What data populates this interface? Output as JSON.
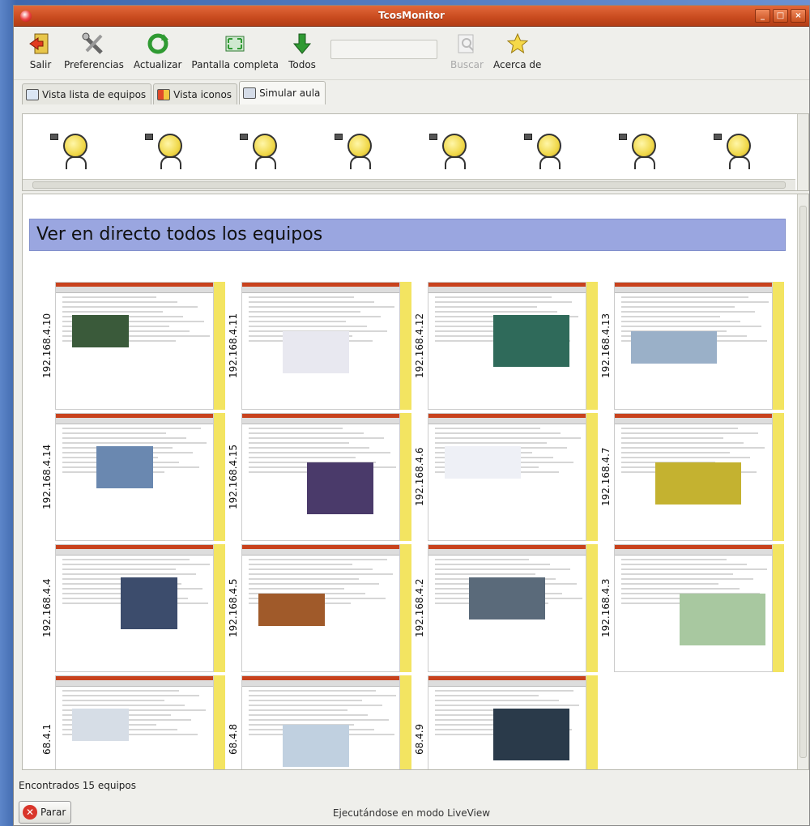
{
  "window": {
    "title": "TcosMonitor"
  },
  "toolbar": {
    "items": [
      {
        "label": "Salir",
        "icon": "exit-icon"
      },
      {
        "label": "Preferencias",
        "icon": "tools-icon"
      },
      {
        "label": "Actualizar",
        "icon": "refresh-icon"
      },
      {
        "label": "Pantalla completa",
        "icon": "fullscreen-icon"
      },
      {
        "label": "Todos",
        "icon": "down-arrow-icon"
      }
    ],
    "search_label": "Buscar",
    "about_label": "Acerca de"
  },
  "tabs": [
    {
      "label": "Vista lista de equipos"
    },
    {
      "label": "Vista iconos"
    },
    {
      "label": "Simular aula"
    }
  ],
  "liveview": {
    "heading": "Ver en directo todos los equipos",
    "hosts": [
      "192.168.4.10",
      "192.168.4.11",
      "192.168.4.12",
      "192.168.4.13",
      "192.168.4.14",
      "192.168.4.15",
      "192.168.4.6",
      "192.168.4.7",
      "192.168.4.4",
      "192.168.4.5",
      "192.168.4.2",
      "192.168.4.3",
      "68.4.1",
      "68.4.8",
      "68.4.9"
    ]
  },
  "status": {
    "found": "Encontrados 15 equipos",
    "stop_label": "Parar",
    "mode": "Ejecutándose en modo LiveView"
  },
  "colors": {
    "titlebar": "#c84a1e",
    "heading_bg": "#9aa6e0",
    "host_bar": "#f3e461"
  }
}
